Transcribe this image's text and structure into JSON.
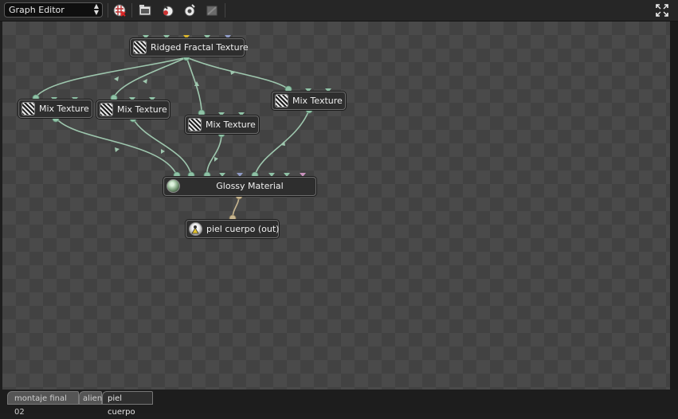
{
  "toolbar": {
    "editor_select": "Graph Editor",
    "icons": [
      "render-stop-icon",
      "render-camera-icon",
      "material-preview-icon",
      "object-preview-icon",
      "disabled-node-icon"
    ]
  },
  "nodes": {
    "ridged": {
      "label": "Ridged Fractal Texture",
      "icon": "texture-icon"
    },
    "mix1": {
      "label": "Mix Texture",
      "icon": "texture-icon"
    },
    "mix2": {
      "label": "Mix Texture",
      "icon": "texture-icon"
    },
    "mix3": {
      "label": "Mix Texture",
      "icon": "texture-icon"
    },
    "mix4": {
      "label": "Mix Texture",
      "icon": "texture-icon"
    },
    "glossy": {
      "label": "Glossy Material",
      "icon": "material-sphere-icon"
    },
    "output": {
      "label": "piel cuerpo (out)",
      "icon": "output-icon"
    }
  },
  "tabs": [
    {
      "label": "montaje final 02",
      "active": false
    },
    {
      "label": "alien",
      "active": false
    },
    {
      "label": "piel cuerpo",
      "active": true
    }
  ],
  "colors": {
    "wire": "#9ec7ae",
    "wire_output": "#c8b690",
    "port_default": "#8fc2a6",
    "port_yellow": "#d9b52c",
    "port_blue": "#8f9bc6",
    "port_pink": "#c892bc"
  }
}
